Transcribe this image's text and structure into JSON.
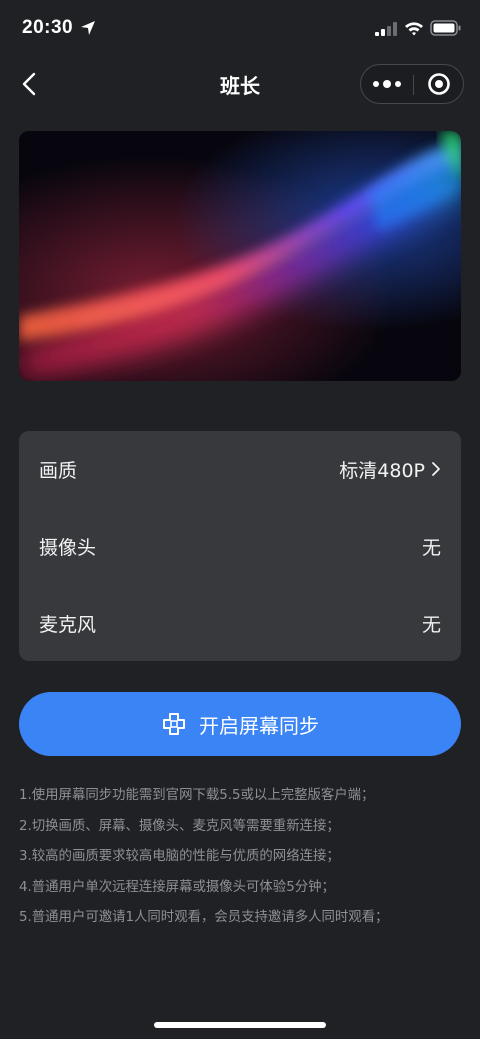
{
  "status_bar": {
    "time": "20:30"
  },
  "nav": {
    "title": "班长"
  },
  "settings": [
    {
      "label": "画质",
      "value": "标清480P",
      "has_arrow": true
    },
    {
      "label": "摄像头",
      "value": "无",
      "has_arrow": false
    },
    {
      "label": "麦克风",
      "value": "无",
      "has_arrow": false
    }
  ],
  "start_button": {
    "label": "开启屏幕同步",
    "color": "#3a84f6"
  },
  "notes": [
    "1.使用屏幕同步功能需到官网下载5.5或以上完整版客户端；",
    "2.切换画质、屏幕、摄像头、麦克风等需要重新连接；",
    "3.较高的画质要求较高电脑的性能与优质的网络连接；",
    "4.普通用户单次远程连接屏幕或摄像头可体验5分钟；",
    "5.普通用户可邀请1人同时观看，会员支持邀请多人同时观看；"
  ],
  "colors": {
    "background": "#1f2124",
    "card": "#37393d",
    "accent": "#3a84f6"
  },
  "icons": {
    "location": "location-arrow-icon",
    "signal": "cellular-signal-icon",
    "wifi": "wifi-icon",
    "battery": "battery-icon",
    "back": "chevron-left-icon",
    "more": "more-dots-icon",
    "close_mini": "target-circle-icon",
    "arrow": "chevron-right-icon",
    "sync": "screen-sync-icon"
  }
}
